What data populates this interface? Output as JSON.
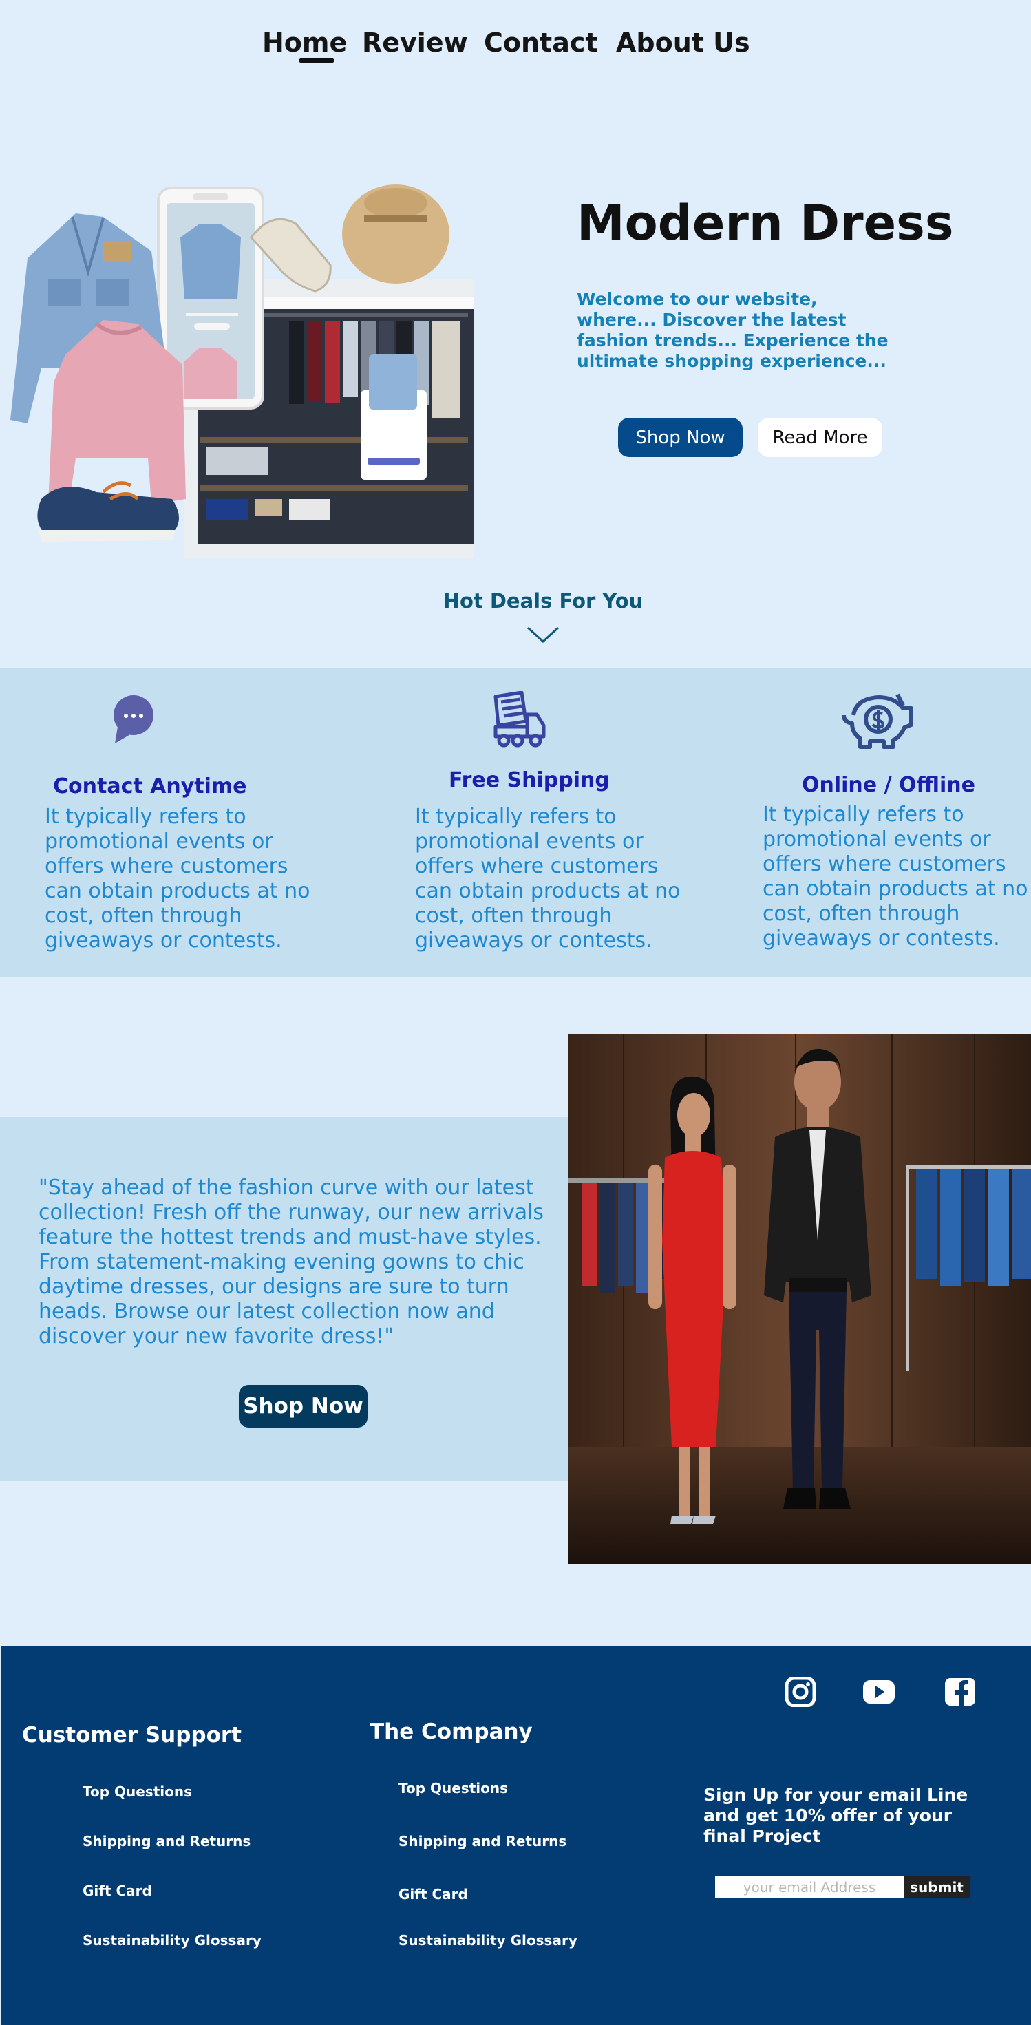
{
  "nav": {
    "items": [
      {
        "label": "Home",
        "active": true
      },
      {
        "label": "Review"
      },
      {
        "label": "Contact"
      },
      {
        "label": "About Us"
      }
    ]
  },
  "hero": {
    "title": "Modern Dress",
    "description": "Welcome to our website, where... Discover the latest fashion trends... Experience the ultimate shopping experience...",
    "shop_button": "Shop Now",
    "read_button": "Read More"
  },
  "hot_deals": {
    "label": "Hot  Deals For You",
    "icon": "chevron-down-icon"
  },
  "features": [
    {
      "icon": "chat-bubble-icon",
      "title": "Contact Anytime",
      "text": "It typically refers to promotional events or offers where customers can obtain products at no cost, often through giveaways or contests."
    },
    {
      "icon": "delivery-truck-icon",
      "title": "Free Shipping",
      "text": "It typically refers to promotional events or offers where customers can obtain products at no cost, often through giveaways or contests."
    },
    {
      "icon": "piggy-bank-icon",
      "title": "Online / Offline",
      "text": "It typically refers to promotional events or offers where customers can obtain products at no cost, often through giveaways or contests."
    }
  ],
  "promo": {
    "text": "\"Stay ahead of the fashion curve with our latest collection! Fresh off the runway, our new arrivals feature the hottest trends and must-have styles. From statement-making evening gowns to chic daytime dresses, our designs are sure to turn heads. Browse our latest collection now and discover your new favorite dress!\"",
    "button": "Shop Now"
  },
  "footer": {
    "support": {
      "heading": "Customer Support",
      "links": [
        "Top Questions",
        "Shipping and Returns",
        "Gift Card",
        "Sustainability Glossary"
      ]
    },
    "company": {
      "heading": "The Company",
      "links": [
        "Top Questions",
        "Shipping and Returns",
        "Gift Card",
        "Sustainability Glossary"
      ]
    },
    "social": [
      "instagram-icon",
      "youtube-icon",
      "facebook-icon"
    ],
    "signup_text": "Sign Up for your email Line and get 10% offer of your final Project",
    "email_placeholder": "your email Address",
    "submit_label": "submit"
  },
  "colors": {
    "page_bg": "#e0eefb",
    "band_bg": "#c3dff0",
    "primary_button": "#054b8c",
    "feature_title": "#1b1eaa",
    "body_text": "#1e88d0",
    "footer_bg": "#033b73"
  }
}
